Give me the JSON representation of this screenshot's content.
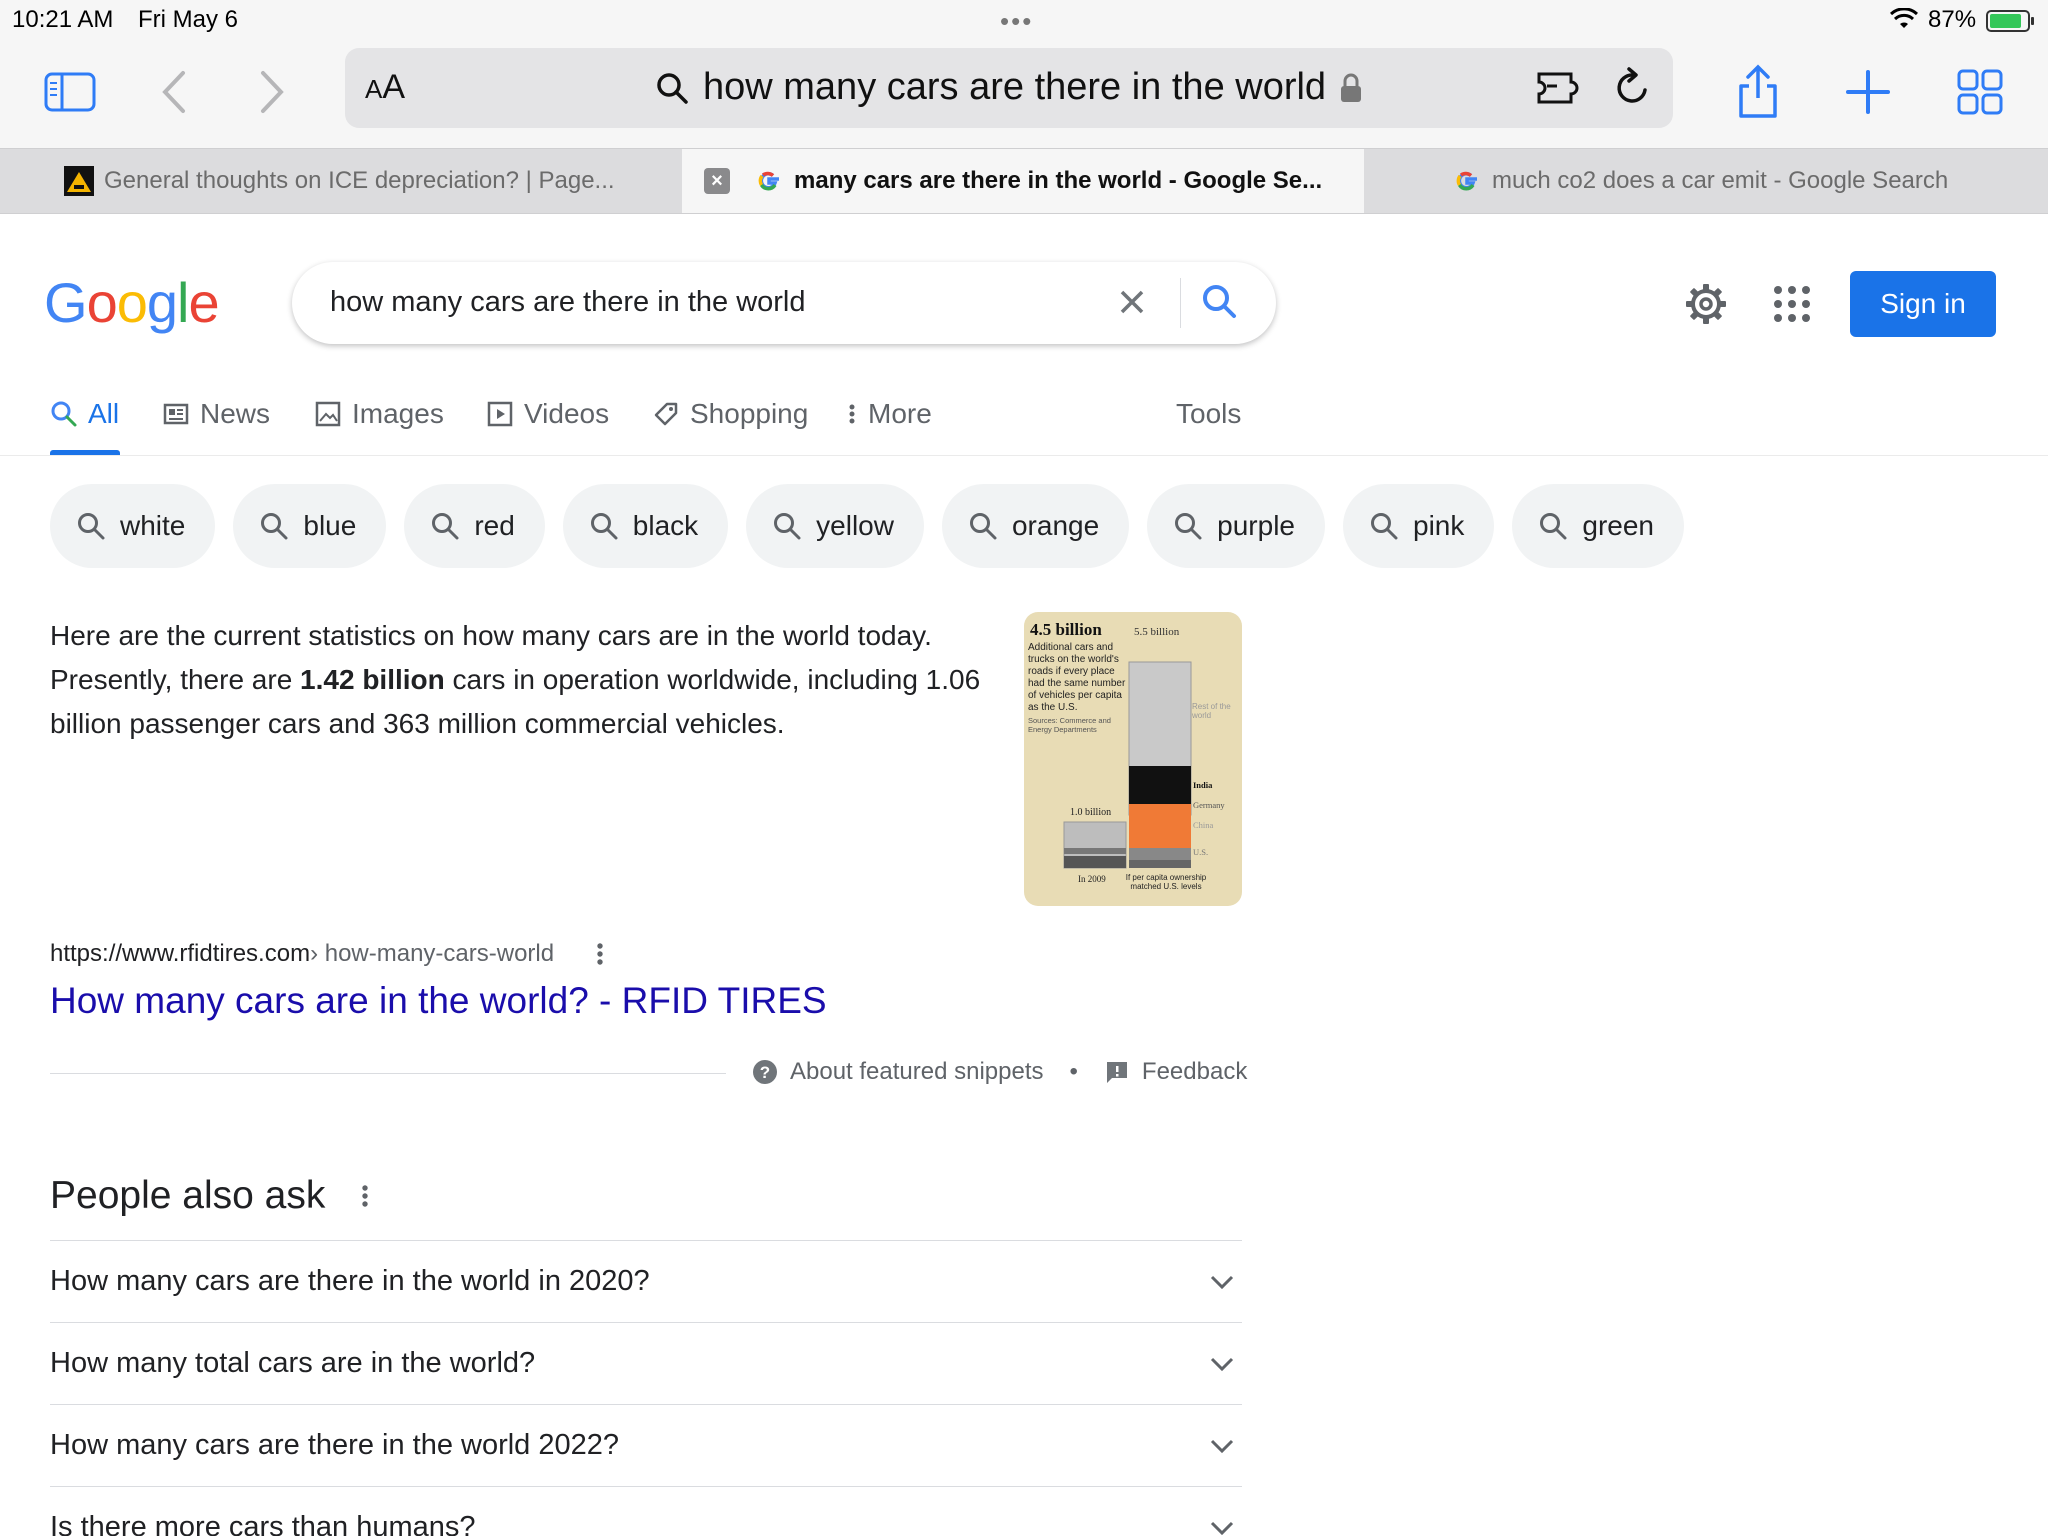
{
  "status_bar": {
    "time": "10:21 AM",
    "date": "Fri May 6",
    "battery": "87%",
    "battery_level": 0.87
  },
  "toolbar": {
    "aa_label_big": "A",
    "aa_label_small": "A",
    "url_query": "how many cars are there in the world"
  },
  "tabs": [
    {
      "title": "General thoughts on ICE depreciation? | Page...",
      "active": false
    },
    {
      "title": "many cars are there in the world - Google Se...",
      "active": true
    },
    {
      "title": "much co2 does a car emit - Google Search",
      "active": false
    }
  ],
  "google": {
    "search_value": "how many cars are there in the world",
    "sign_in": "Sign in",
    "nav": {
      "all": "All",
      "news": "News",
      "images": "Images",
      "videos": "Videos",
      "shopping": "Shopping",
      "more": "More",
      "tools": "Tools"
    },
    "chips": [
      "white",
      "blue",
      "red",
      "black",
      "yellow",
      "orange",
      "purple",
      "pink",
      "green"
    ]
  },
  "snippet": {
    "text_part1": "Here are the current statistics on how many cars are in the world today. Presently, there are ",
    "text_bold": "1.42 billion",
    "text_part2": " cars in operation worldwide, including 1.06 billion passenger cars and 363 million commercial vehicles.",
    "image": {
      "headline": "4.5 billion",
      "top_label": "5.5 billion",
      "caption": "Additional cars and trucks on the world's roads if every place had the same number of vehicles per capita as the U.S.",
      "sources": "Sources: Commerce and Energy Departments",
      "left_label": "1.0 billion",
      "legend_rest": "Rest of the world",
      "legend_india": "India",
      "legend_germany": "Germany",
      "legend_china": "China",
      "legend_us": "U.S.",
      "x_left": "In 2009",
      "x_right": "If per capita ownership matched U.S. levels"
    },
    "source_domain": "https://www.rfidtires.com",
    "source_path": " › how-many-cars-world",
    "title": "How many cars are in the world? - RFID TIRES",
    "about": "About featured snippets",
    "bullet": "•",
    "feedback": "Feedback"
  },
  "paa": {
    "title": "People also ask",
    "questions": [
      "How many cars are there in the world in 2020?",
      "How many total cars are in the world?",
      "How many cars are there in the world 2022?",
      "Is there more cars than humans?"
    ]
  },
  "colors": {
    "google_blue": "#4285F4",
    "google_red": "#EA4335",
    "google_yellow": "#FBBC05",
    "google_green": "#34A853",
    "link": "#1a0dab",
    "accent": "#1a73e8"
  }
}
